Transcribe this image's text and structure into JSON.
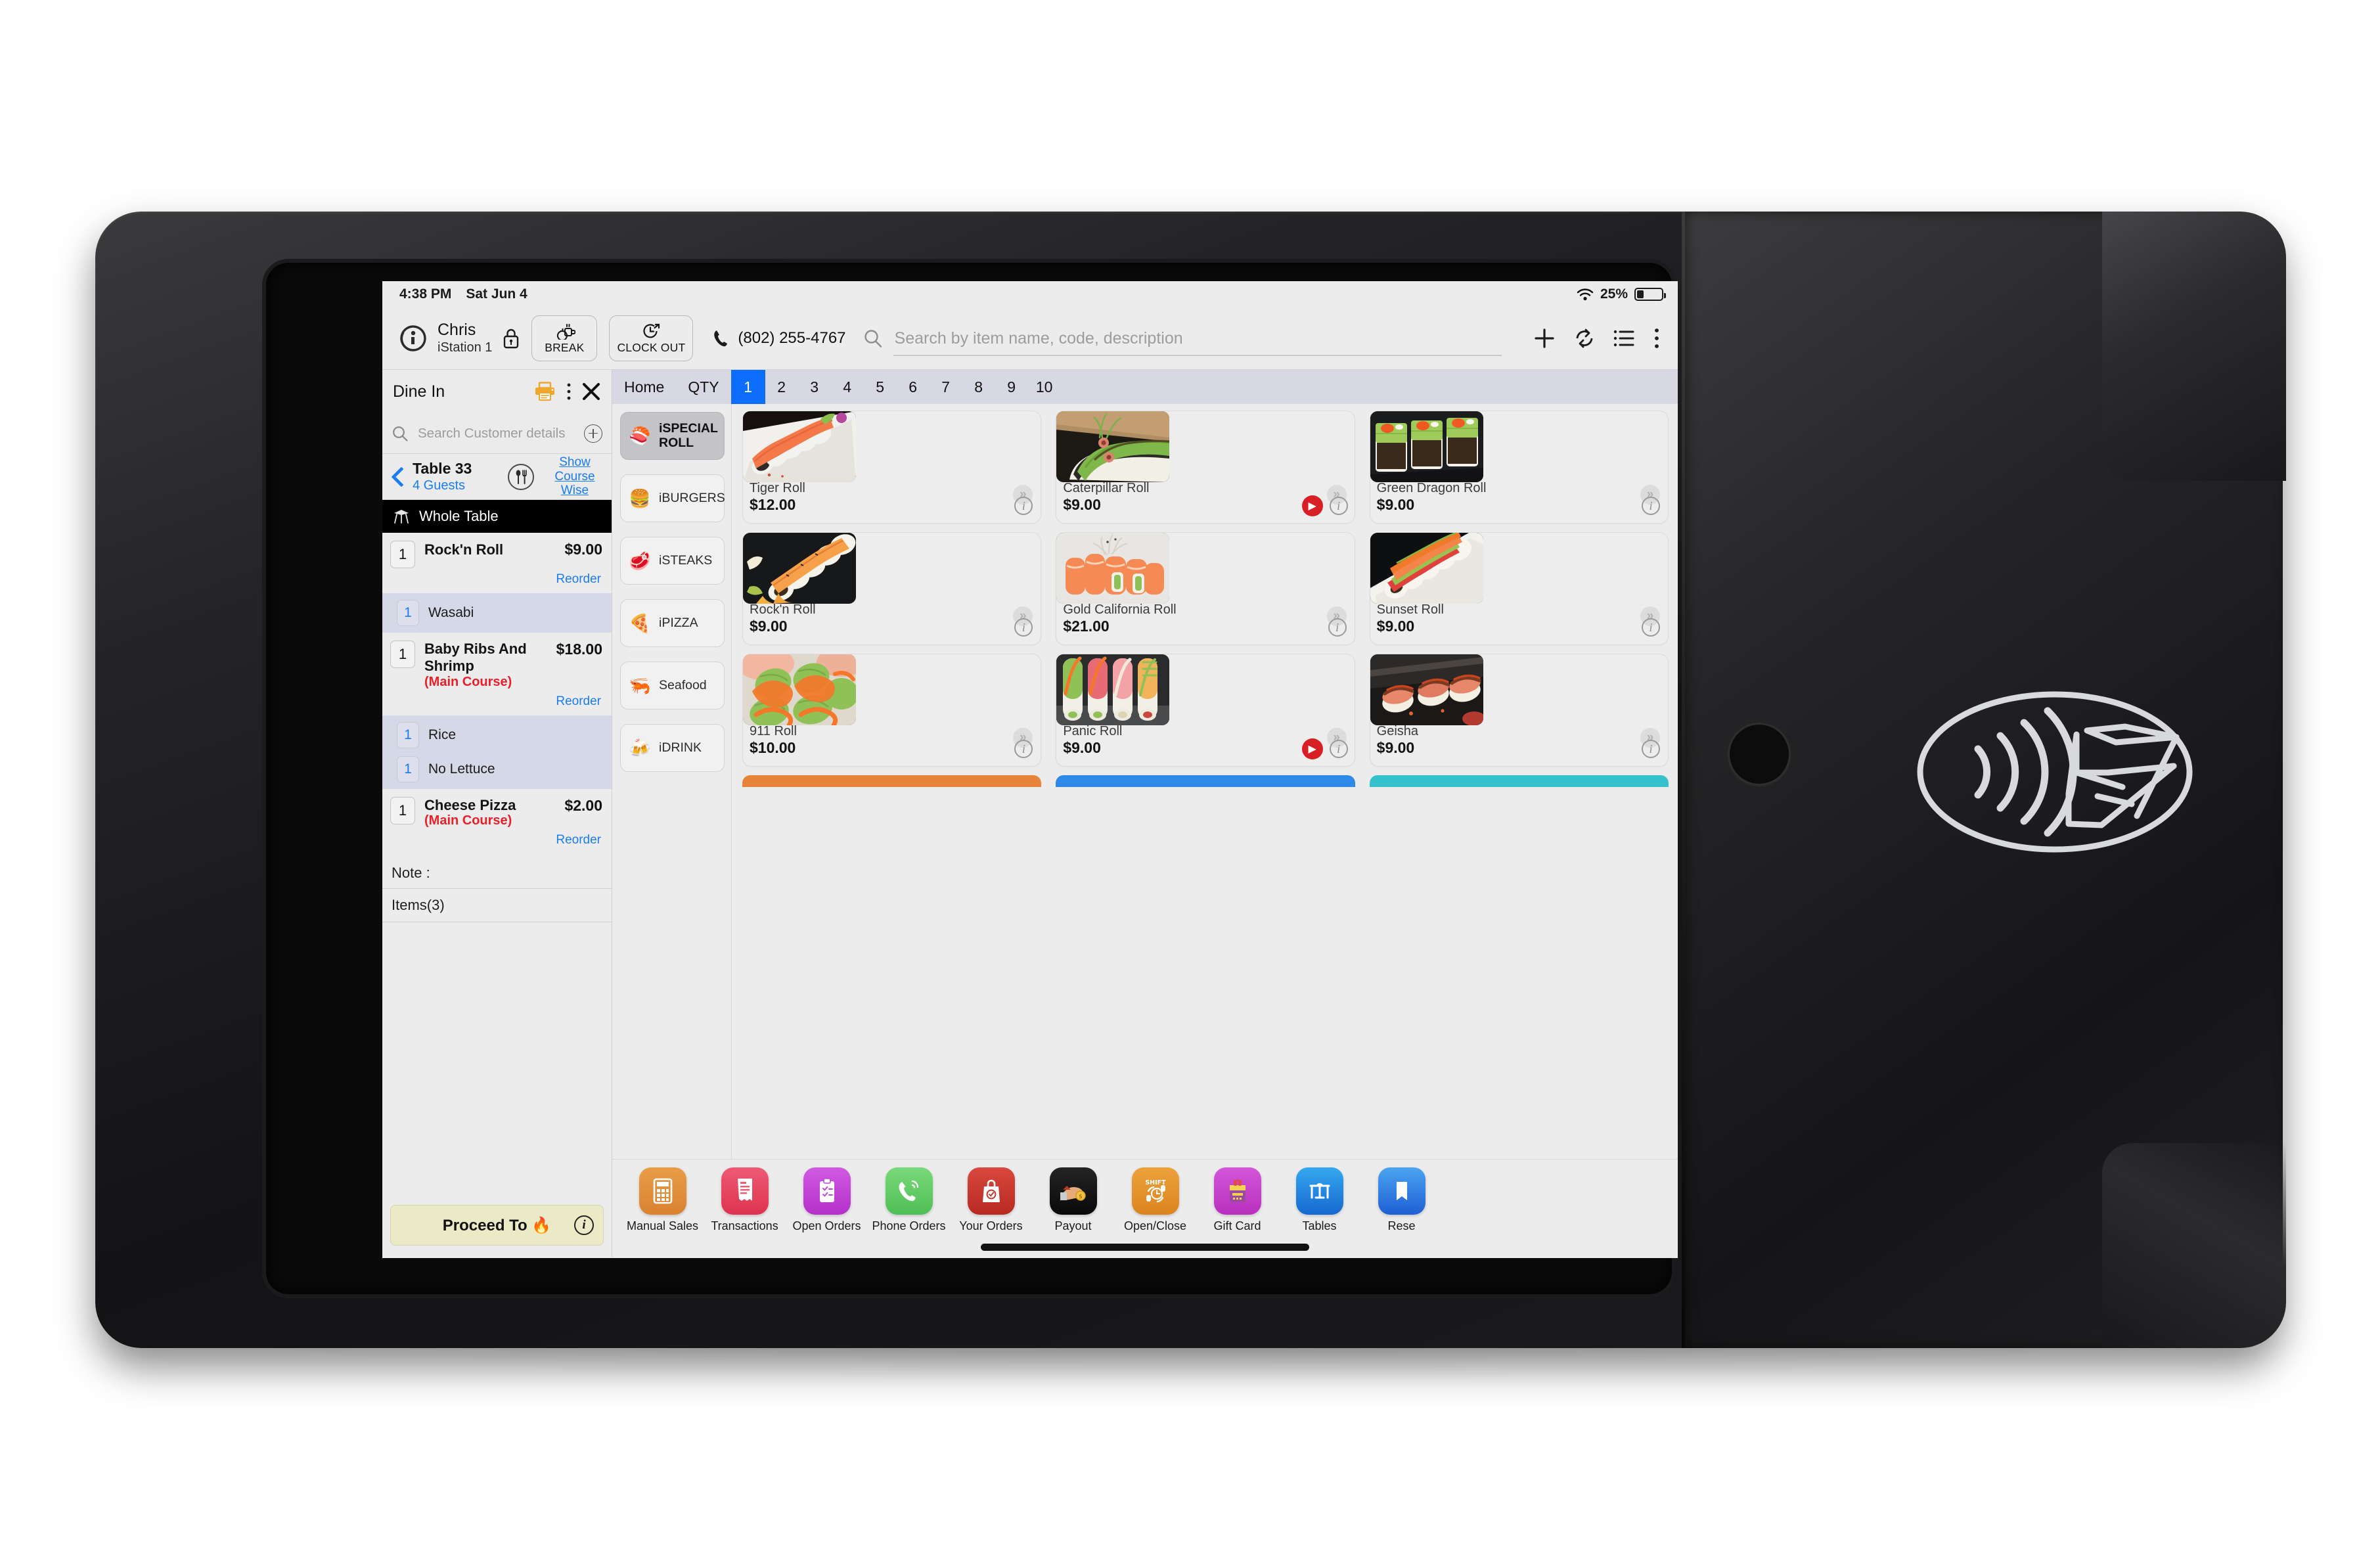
{
  "status_bar": {
    "time": "4:38 PM",
    "date": "Sat Jun 4",
    "battery_pct": "25%"
  },
  "header": {
    "user_name": "Chris",
    "station": "iStation 1",
    "lock_icon": "lock-icon",
    "break_label": "BREAK",
    "clock_out_label": "CLOCK OUT",
    "phone": "(802) 255-4767",
    "search_placeholder": "Search by item name, code, description",
    "search_value": "",
    "icons": [
      "plus-icon",
      "sync-icon",
      "list-icon",
      "more-vertical-icon"
    ]
  },
  "order_panel": {
    "order_type": "Dine In",
    "printer_icon": "printer-icon",
    "more_icon": "more-vertical-icon",
    "close_icon": "close-icon",
    "customer_search_placeholder": "Search Customer details",
    "add_customer_icon": "plus-circle-icon",
    "table_name": "Table 33",
    "guests": "4 Guests",
    "cutlery_icon": "cutlery-icon",
    "show_course_wise": "Show Course Wise",
    "section_header": "Whole Table",
    "section_icon": "table-icon",
    "items": [
      {
        "qty": "1",
        "name": "Rock'n Roll",
        "course": "",
        "price": "$9.00",
        "reorder_label": "Reorder",
        "modifiers": [
          {
            "qty": "1",
            "name": "Wasabi"
          }
        ]
      },
      {
        "qty": "1",
        "name": "Baby Ribs And Shrimp",
        "course": "(Main Course)",
        "price": "$18.00",
        "reorder_label": "Reorder",
        "modifiers": [
          {
            "qty": "1",
            "name": "Rice"
          },
          {
            "qty": "1",
            "name": "No Lettuce"
          }
        ]
      },
      {
        "qty": "1",
        "name": "Cheese Pizza",
        "course": "(Main Course)",
        "price": "$2.00",
        "reorder_label": "Reorder",
        "modifiers": []
      }
    ],
    "note_label": "Note :",
    "items_count_label": "Items(3)",
    "proceed_label": "Proceed To 🔥",
    "proceed_info_icon": "info-icon"
  },
  "tabs": {
    "home": "Home",
    "qty": "QTY",
    "numbers": [
      "1",
      "2",
      "3",
      "4",
      "5",
      "6",
      "7",
      "8",
      "9",
      "10"
    ],
    "active": "1"
  },
  "categories": [
    {
      "label": "iSPECIAL ROLL",
      "emoji": "🍣",
      "icon": "sushi-icon",
      "active": true
    },
    {
      "label": "iBURGERS",
      "emoji": "🍔",
      "icon": "burger-icon",
      "active": false
    },
    {
      "label": "iSTEAKS",
      "emoji": "🥩",
      "icon": "steak-icon",
      "active": false
    },
    {
      "label": "iPIZZA",
      "emoji": "🍕",
      "icon": "pizza-icon",
      "active": false
    },
    {
      "label": "Seafood",
      "emoji": "🦐",
      "icon": "shrimp-icon",
      "active": false
    },
    {
      "label": "iDRINK",
      "emoji": "🍻",
      "icon": "beer-icon",
      "active": false
    }
  ],
  "products": [
    {
      "name": "Tiger Roll",
      "price": "$12.00",
      "has_play": false,
      "img": "salmon-roll-white-plate"
    },
    {
      "name": "Caterpillar Roll",
      "price": "$9.00",
      "has_play": true,
      "img": "avocado-roll-closeup"
    },
    {
      "name": "Green Dragon Roll",
      "price": "$9.00",
      "has_play": false,
      "img": "avocado-roe-roll-slate"
    },
    {
      "name": "Rock'n Roll",
      "price": "$9.00",
      "has_play": false,
      "img": "salmon-roll-slate-orange"
    },
    {
      "name": "Gold California Roll",
      "price": "$21.00",
      "has_play": false,
      "img": "salmon-wrapped-roll"
    },
    {
      "name": "Sunset Roll",
      "price": "$9.00",
      "has_play": false,
      "img": "tuna-salmon-roll-plate"
    },
    {
      "name": "911 Roll",
      "price": "$10.00",
      "has_play": false,
      "img": "spicy-avocado-roll"
    },
    {
      "name": "Panic Roll",
      "price": "$9.00",
      "has_play": true,
      "img": "four-rainbow-rolls"
    },
    {
      "name": "Geisha",
      "price": "$9.00",
      "has_play": false,
      "img": "seared-nigiri-dark"
    }
  ],
  "partial_cards": [
    {
      "color": "#e8833a"
    },
    {
      "color": "#2d8ae8"
    },
    {
      "color": "#35c2cc"
    }
  ],
  "app_toolbar": [
    {
      "label": "Manual Sales",
      "icon": "calculator-icon",
      "color": "#e08b33",
      "glyph": "⌸"
    },
    {
      "label": "Transactions",
      "icon": "receipt-icon",
      "color": "#e94a5f",
      "glyph": "🧾"
    },
    {
      "label": "Open Orders",
      "icon": "clipboard-check-icon",
      "color": "#c34ad6",
      "glyph": "📋"
    },
    {
      "label": "Phone Orders",
      "icon": "phone-call-icon",
      "color": "#62cb63",
      "glyph": "📞"
    },
    {
      "label": "Your Orders",
      "icon": "bag-check-icon",
      "color": "#cf3a30",
      "glyph": "👜"
    },
    {
      "label": "Payout",
      "icon": "hand-cash-icon",
      "color": "#161616",
      "glyph": "🤝"
    },
    {
      "label": "Open/Close",
      "icon": "shift-clock-icon",
      "color": "#e2912f",
      "glyph": "⏱"
    },
    {
      "label": "Gift Card",
      "icon": "gift-card-icon",
      "color": "#c942c9",
      "glyph": "🎁"
    },
    {
      "label": "Tables",
      "icon": "tables-icon",
      "color": "#1f7fe0",
      "glyph": "🪑"
    },
    {
      "label": "Rese",
      "icon": "reservation-icon",
      "color": "#2d7fe8",
      "glyph": "🗓"
    }
  ],
  "device": {
    "nfc_icon": "contactless-payment-icon",
    "home_button": "home-button"
  },
  "colors": {
    "accent_blue": "#0d6efd",
    "link_blue": "#1a7cf0",
    "course_red": "#e8202a",
    "proceed_bg": "#eaeac7",
    "play_red": "#d81f26"
  }
}
